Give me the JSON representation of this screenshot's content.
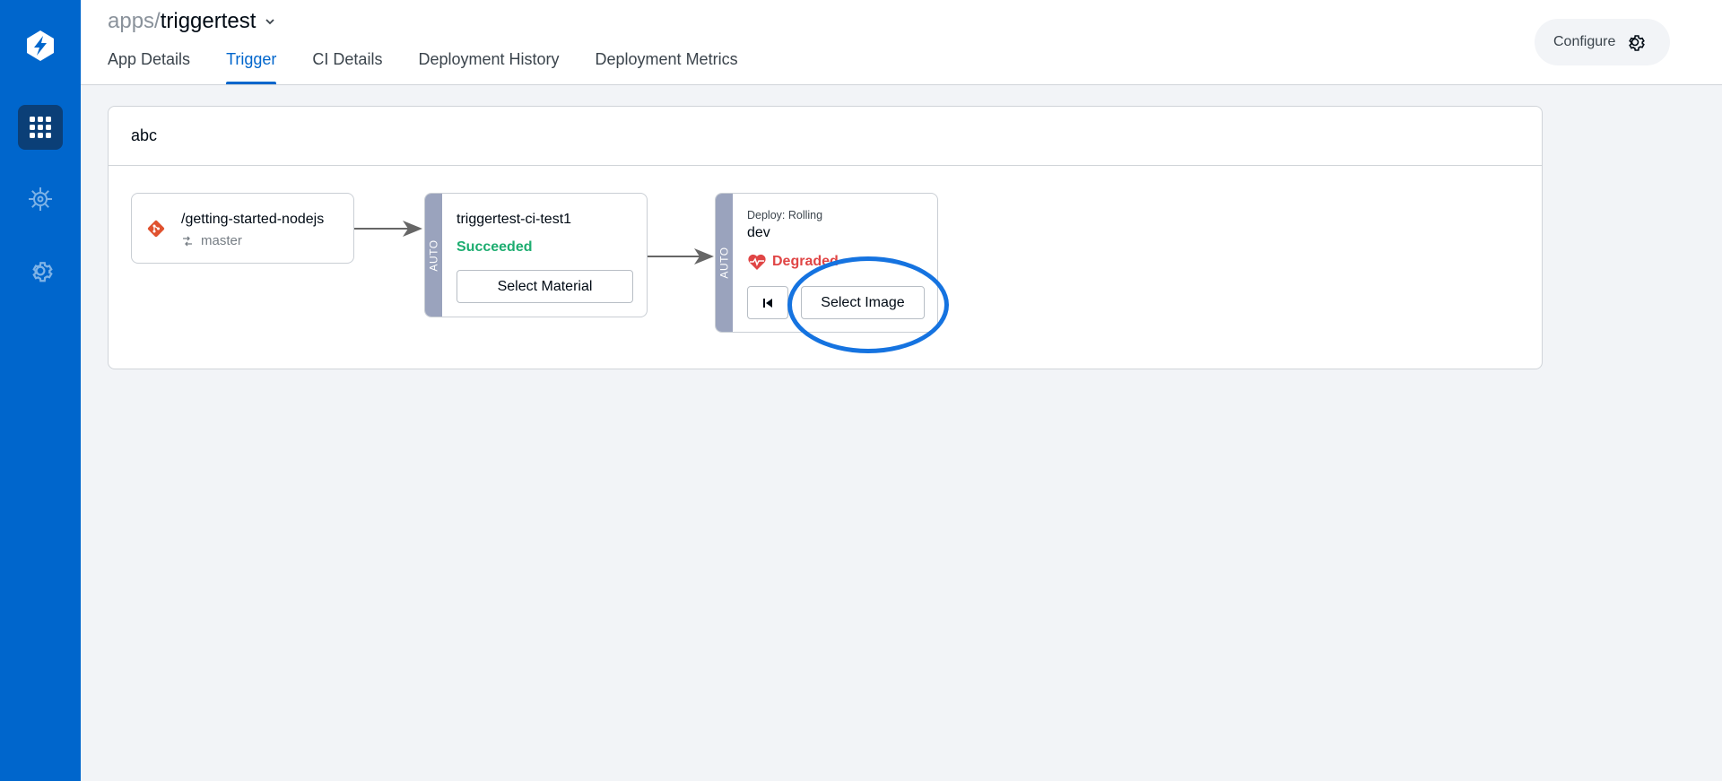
{
  "breadcrumb": {
    "prefix": "apps/",
    "app_name": "triggertest"
  },
  "tabs": [
    {
      "label": "App Details",
      "active": false
    },
    {
      "label": "Trigger",
      "active": true
    },
    {
      "label": "CI Details",
      "active": false
    },
    {
      "label": "Deployment History",
      "active": false
    },
    {
      "label": "Deployment Metrics",
      "active": false
    }
  ],
  "configure": {
    "label": "Configure",
    "icon": "gear-icon"
  },
  "sidebar": {
    "items": [
      {
        "name": "logo",
        "icon": "devtron-logo"
      },
      {
        "name": "applications",
        "icon": "apps-grid-icon",
        "active": true
      },
      {
        "name": "charts",
        "icon": "chart-store-icon"
      },
      {
        "name": "global-config",
        "icon": "gear-icon"
      }
    ]
  },
  "workflow": {
    "name": "abc",
    "git_material": {
      "repo": "/getting-started-nodejs",
      "branch": "master"
    },
    "ci": {
      "trigger_mode": "AUTO",
      "name": "triggertest-ci-test1",
      "status": "Succeeded",
      "button_label": "Select Material"
    },
    "cd": {
      "trigger_mode": "AUTO",
      "deploy_strategy": "Deploy: Rolling",
      "environment": "dev",
      "status": "Degraded",
      "button_label": "Select Image"
    }
  },
  "colors": {
    "sidebar": "#0066cc",
    "accent": "#0066cc",
    "succeeded": "#1dad70",
    "degraded": "#e04545",
    "highlight": "#1573e0"
  }
}
